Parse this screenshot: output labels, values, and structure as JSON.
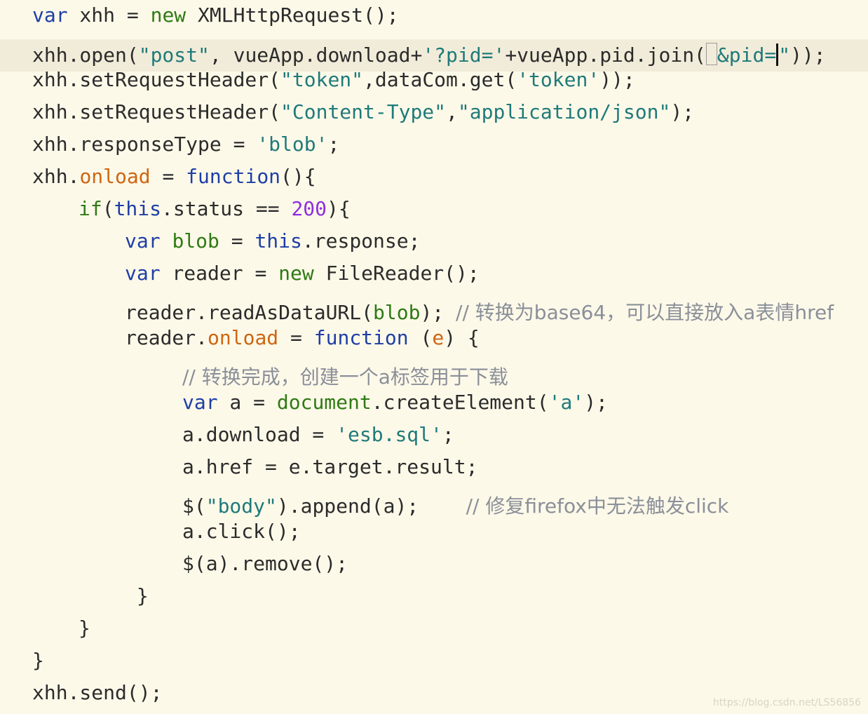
{
  "editor": {
    "lines": [
      {
        "indent": 0,
        "tokens": [
          {
            "t": "var",
            "c": "kw"
          },
          {
            "t": " xhh = "
          },
          {
            "t": "new",
            "c": "nw"
          },
          {
            "t": " XMLHttpRequest();"
          }
        ]
      },
      {
        "indent": 0,
        "current": true,
        "tokens": [
          {
            "t": "xhh.open("
          },
          {
            "t": "\"post\"",
            "c": "str"
          },
          {
            "t": ", vueApp.download+"
          },
          {
            "t": "'?pid='",
            "c": "str"
          },
          {
            "t": "+vueApp.pid.join("
          },
          {
            "t": "\"&pid=\"",
            "c": "str"
          },
          {
            "t": "));"
          }
        ]
      },
      {
        "indent": 0,
        "tokens": [
          {
            "t": "xhh.setRequestHeader("
          },
          {
            "t": "\"token\"",
            "c": "str"
          },
          {
            "t": ",dataCom.get("
          },
          {
            "t": "'token'",
            "c": "str"
          },
          {
            "t": "));"
          }
        ]
      },
      {
        "indent": 0,
        "tokens": [
          {
            "t": "xhh.setRequestHeader("
          },
          {
            "t": "\"Content-Type\"",
            "c": "str"
          },
          {
            "t": ","
          },
          {
            "t": "\"application/json\"",
            "c": "str"
          },
          {
            "t": ");"
          }
        ]
      },
      {
        "indent": 0,
        "tokens": [
          {
            "t": "xhh.responseType = "
          },
          {
            "t": "'blob'",
            "c": "str"
          },
          {
            "t": ";"
          }
        ]
      },
      {
        "indent": 0,
        "tokens": [
          {
            "t": "xhh."
          },
          {
            "t": "onload",
            "c": "prop"
          },
          {
            "t": " = "
          },
          {
            "t": "function",
            "c": "kw"
          },
          {
            "t": "(){"
          }
        ]
      },
      {
        "indent": 1,
        "tokens": [
          {
            "t": "if",
            "c": "nw"
          },
          {
            "t": "("
          },
          {
            "t": "this",
            "c": "kw"
          },
          {
            "t": ".status == "
          },
          {
            "t": "200",
            "c": "num"
          },
          {
            "t": "){"
          }
        ]
      },
      {
        "indent": 2,
        "tokens": [
          {
            "t": "var",
            "c": "kw"
          },
          {
            "t": " "
          },
          {
            "t": "blob",
            "c": "nw"
          },
          {
            "t": " = "
          },
          {
            "t": "this",
            "c": "kw"
          },
          {
            "t": ".response;"
          }
        ]
      },
      {
        "indent": 2,
        "tokens": [
          {
            "t": "var",
            "c": "kw"
          },
          {
            "t": " reader = "
          },
          {
            "t": "new",
            "c": "nw"
          },
          {
            "t": " FileReader();"
          }
        ]
      },
      {
        "indent": 2,
        "tokens": [
          {
            "t": "reader.readAsDataURL("
          },
          {
            "t": "blob",
            "c": "nw"
          },
          {
            "t": "); "
          },
          {
            "t": "// 转换为base64，可以直接放入a表情href",
            "c": "cmt"
          }
        ]
      },
      {
        "indent": 2,
        "tokens": [
          {
            "t": "reader."
          },
          {
            "t": "onload",
            "c": "prop"
          },
          {
            "t": " = "
          },
          {
            "t": "function",
            "c": "kw"
          },
          {
            "t": " ("
          },
          {
            "t": "e",
            "c": "prop"
          },
          {
            "t": ") {"
          }
        ]
      },
      {
        "indent": 3,
        "tokens": [
          {
            "t": "// 转换完成，创建一个a标签用于下载",
            "c": "cmt"
          }
        ]
      },
      {
        "indent": 3,
        "tokens": [
          {
            "t": "var",
            "c": "kw"
          },
          {
            "t": " a = "
          },
          {
            "t": "document",
            "c": "nw"
          },
          {
            "t": ".createElement("
          },
          {
            "t": "'a'",
            "c": "str"
          },
          {
            "t": ");"
          }
        ]
      },
      {
        "indent": 3,
        "tokens": [
          {
            "t": "a.download = "
          },
          {
            "t": "'esb.sql'",
            "c": "str"
          },
          {
            "t": ";"
          }
        ]
      },
      {
        "indent": 3,
        "tokens": [
          {
            "t": "a.href = e.target.result;"
          }
        ]
      },
      {
        "indent": 3,
        "tokens": [
          {
            "t": "$("
          },
          {
            "t": "\"body\"",
            "c": "str"
          },
          {
            "t": ").append(a);    "
          },
          {
            "t": "// 修复firefox中无法触发click",
            "c": "cmt"
          }
        ]
      },
      {
        "indent": 3,
        "tokens": [
          {
            "t": "a.click();"
          }
        ]
      },
      {
        "indent": 3,
        "tokens": [
          {
            "t": "$(a).remove();"
          }
        ]
      },
      {
        "indent": 2,
        "tokens": [
          {
            "t": " }"
          }
        ]
      },
      {
        "indent": 1,
        "tokens": [
          {
            "t": "}"
          }
        ]
      },
      {
        "indent": 0,
        "tokens": [
          {
            "t": "}"
          }
        ]
      },
      {
        "indent": 0,
        "tokens": [
          {
            "t": "xhh.send();"
          }
        ]
      }
    ]
  },
  "watermark": "https://blog.csdn.net/LS56856"
}
